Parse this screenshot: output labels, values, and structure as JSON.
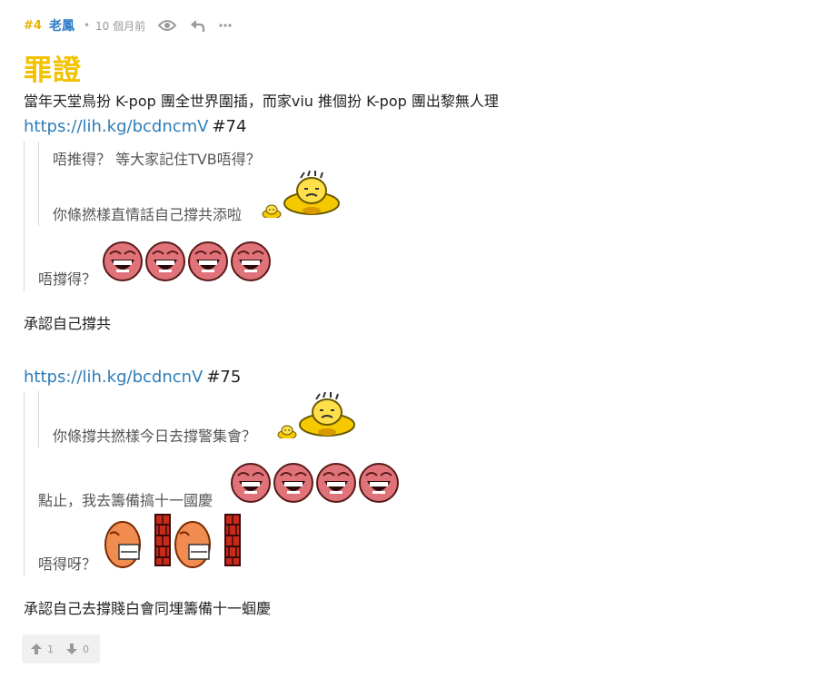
{
  "header": {
    "floor": "#4",
    "author": "老鳳",
    "time": "10 個月前",
    "icons": [
      "eye-icon",
      "reply-icon",
      "more-icon"
    ]
  },
  "title": "罪證",
  "intro": "當年天堂鳥扮 K-pop 團全世界圍插，而家viu 推個扮 K-pop 團出黎無人理",
  "ref1": {
    "link": "https://lih.kg/bcdncmV",
    "num": "#74",
    "inner_line1": "唔推得？ 等大家記住TVB唔得？",
    "inner_line2": "你條撚樣直情話自己撐共添啦",
    "outer_line": "唔撐得？"
  },
  "comment1": "承認自己撐共",
  "ref2": {
    "link": "https://lih.kg/bcdncnV",
    "num": "#75",
    "inner_line1": "你條撐共撚樣今日去撐警集會？",
    "outer_line1": "點止，我去籌備搞十一國慶",
    "outer_line2": "唔得呀？"
  },
  "comment2": "承認自己去撐賤白會同埋籌備十一蝈慶",
  "votes": {
    "up": "1",
    "down": "0"
  },
  "colors": {
    "floor": "#e8b400",
    "author": "#2d7cc7",
    "title": "#f2c200",
    "link": "#2e7db8"
  }
}
